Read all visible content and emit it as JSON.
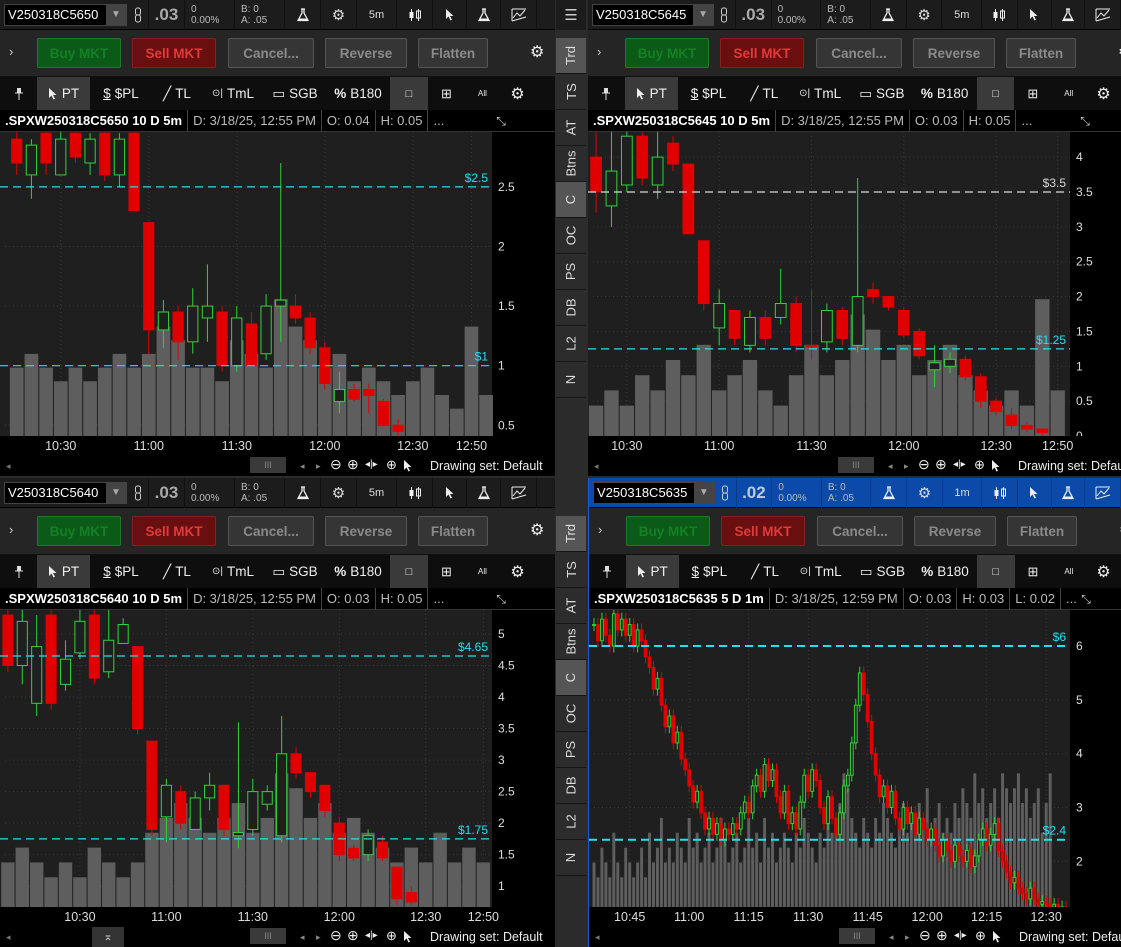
{
  "orders": {
    "buy": "Buy MKT",
    "sell": "Sell MKT",
    "cancel": "Cancel...",
    "reverse": "Reverse",
    "flatten": "Flatten"
  },
  "tools": {
    "pt": "PT",
    "pl": "$PL",
    "tl": "TL",
    "tml": "TmL",
    "sgb": "SGB",
    "b180": "B180",
    "all": "All"
  },
  "sidebar": {
    "tabs": [
      "Trd",
      "TS",
      "AT",
      "Btns",
      "C",
      "OC",
      "PS",
      "DB",
      "L2",
      "N"
    ],
    "active": [
      "Trd",
      "C"
    ]
  },
  "panels": [
    {
      "symbol": "V250318C5650",
      "last": ".03",
      "chg": "0",
      "chg_pct": "0.00%",
      "bid": "B: 0",
      "ask": "A: .05",
      "agg": "5m",
      "active": false,
      "title": ".SPXW250318C5650 10 D 5m",
      "date": "D: 3/18/25, 12:55 PM",
      "open": "O: 0.04",
      "high": "H: 0.05",
      "low": null,
      "more": "...",
      "drawing_set": "Drawing set: Default"
    },
    {
      "symbol": "V250318C5645",
      "last": ".03",
      "chg": "0",
      "chg_pct": "0.00%",
      "bid": "B: 0",
      "ask": "A: .05",
      "agg": "5m",
      "active": false,
      "title": ".SPXW250318C5645 10 D 5m",
      "date": "D: 3/18/25, 12:55 PM",
      "open": "O: 0.03",
      "high": "H: 0.05",
      "low": null,
      "more": "...",
      "drawing_set": "Drawing set: Default"
    },
    {
      "symbol": "V250318C5640",
      "last": ".03",
      "chg": "0",
      "chg_pct": "0.00%",
      "bid": "B: 0",
      "ask": "A: .05",
      "agg": "5m",
      "active": false,
      "title": ".SPXW250318C5640 10 D 5m",
      "date": "D: 3/18/25, 12:55 PM",
      "open": "O: 0.03",
      "high": "H: 0.05",
      "low": null,
      "more": "...",
      "drawing_set": "Drawing set: Default"
    },
    {
      "symbol": "V250318C5635",
      "last": ".02",
      "chg": "0",
      "chg_pct": "0.00%",
      "bid": "B: 0",
      "ask": "A: .05",
      "agg": "1m",
      "active": true,
      "title": ".SPXW250318C5635 5 D 1m",
      "date": "D: 3/18/25, 12:59 PM",
      "open": "O: 0.03",
      "high": "H: 0.03",
      "low": "L: 0.02",
      "more": "...",
      "drawing_set": "Drawing set: Default"
    }
  ],
  "chart_data": [
    {
      "type": "candlestick",
      "title": ".SPXW250318C5650 10 D 5m",
      "ylim": [
        0.41,
        2.96
      ],
      "yticks": [
        "0.5",
        "1",
        "1.5",
        "2",
        "2.5"
      ],
      "xrange": [
        "10:11",
        "12:57"
      ],
      "xticks": [
        "10:30",
        "11:00",
        "11:30",
        "12:00",
        "12:30",
        "12:50"
      ],
      "start": "10:15",
      "bar_minutes": 5,
      "hlines": [
        {
          "price": 2.5,
          "label": "$2.5",
          "color": "#22e0f0"
        },
        {
          "price": 1,
          "label": "$1",
          "color": "#22e0f0"
        }
      ],
      "ohlc": [
        [
          2.9,
          3.0,
          2.6,
          2.7
        ],
        [
          2.6,
          2.9,
          2.4,
          2.85
        ],
        [
          2.95,
          3.0,
          2.6,
          2.7
        ],
        [
          2.6,
          3.0,
          2.6,
          2.9
        ],
        [
          2.95,
          3.0,
          2.7,
          2.75
        ],
        [
          2.7,
          2.95,
          2.6,
          2.9
        ],
        [
          2.95,
          3.0,
          2.55,
          2.6
        ],
        [
          2.6,
          2.95,
          2.5,
          2.9
        ],
        [
          2.95,
          3.0,
          2.3,
          2.3
        ],
        [
          2.2,
          2.2,
          1.1,
          1.3
        ],
        [
          1.3,
          1.55,
          1.15,
          1.45
        ],
        [
          1.45,
          1.5,
          1.05,
          1.2
        ],
        [
          1.2,
          1.65,
          1.1,
          1.5
        ],
        [
          1.4,
          1.85,
          1.2,
          1.5
        ],
        [
          1.45,
          1.5,
          0.95,
          1.0
        ],
        [
          1.0,
          1.5,
          0.95,
          1.4
        ],
        [
          1.35,
          1.45,
          1.0,
          1.0
        ],
        [
          1.1,
          1.6,
          1.05,
          1.5
        ],
        [
          1.5,
          2.7,
          1.2,
          1.55
        ],
        [
          1.5,
          1.6,
          1.35,
          1.4
        ],
        [
          1.4,
          1.45,
          1.1,
          1.15
        ],
        [
          1.15,
          1.2,
          0.8,
          0.85
        ],
        [
          0.7,
          0.95,
          0.6,
          0.8
        ],
        [
          0.8,
          0.85,
          0.7,
          0.72
        ],
        [
          0.8,
          0.85,
          0.6,
          0.75
        ],
        [
          0.7,
          0.72,
          0.5,
          0.5
        ],
        [
          0.5,
          0.55,
          0.4,
          0.45
        ]
      ],
      "volume": [
        5,
        6,
        5,
        4,
        5,
        4,
        5,
        6,
        5,
        6,
        8,
        7,
        5,
        5,
        4,
        7,
        6,
        5,
        10,
        8,
        7,
        5,
        6,
        4,
        5,
        4,
        3,
        4,
        5,
        3,
        2,
        8,
        3,
        2
      ]
    },
    {
      "type": "candlestick",
      "title": ".SPXW250318C5645 10 D 5m",
      "ylim": [
        0,
        4.36
      ],
      "yticks": [
        "0",
        "0.5",
        "1",
        "1.5",
        "2",
        "2.5",
        "3",
        "3.5",
        "4"
      ],
      "xrange": [
        "10:19",
        "12:54"
      ],
      "xticks": [
        "10:30",
        "11:00",
        "11:30",
        "12:00",
        "12:30",
        "12:50"
      ],
      "start": "10:20",
      "bar_minutes": 5,
      "hlines": [
        {
          "price": 3.5,
          "label": "$3.5",
          "color": "#d8d8d8"
        },
        {
          "price": 1.25,
          "label": "$1.25",
          "color": "#22e0f0"
        }
      ],
      "ohlc": [
        [
          4.0,
          4.4,
          3.2,
          3.5
        ],
        [
          3.3,
          4.4,
          3.0,
          3.8
        ],
        [
          3.6,
          4.4,
          3.5,
          4.3
        ],
        [
          4.3,
          4.4,
          3.6,
          3.7
        ],
        [
          3.6,
          4.4,
          3.4,
          4.0
        ],
        [
          4.2,
          4.3,
          3.8,
          3.9
        ],
        [
          3.9,
          3.9,
          2.9,
          2.9
        ],
        [
          2.8,
          2.8,
          1.8,
          1.9
        ],
        [
          1.55,
          2.1,
          1.3,
          1.9
        ],
        [
          1.8,
          1.8,
          1.3,
          1.4
        ],
        [
          1.3,
          1.8,
          1.2,
          1.7
        ],
        [
          1.7,
          1.8,
          1.3,
          1.4
        ],
        [
          1.7,
          2.4,
          1.6,
          1.9
        ],
        [
          1.9,
          2.0,
          1.2,
          1.3
        ],
        [
          1.3,
          2.1,
          1.1,
          1.28
        ],
        [
          1.35,
          1.9,
          1.2,
          1.8
        ],
        [
          1.8,
          1.85,
          1.3,
          1.4
        ],
        [
          1.3,
          3.7,
          1.2,
          2.0
        ],
        [
          2.1,
          2.2,
          1.9,
          2.0
        ],
        [
          2.0,
          2.0,
          1.8,
          1.85
        ],
        [
          1.8,
          1.85,
          1.4,
          1.45
        ],
        [
          1.5,
          1.55,
          1.1,
          1.15
        ],
        [
          0.95,
          1.3,
          0.7,
          1.05
        ],
        [
          1.0,
          1.2,
          0.9,
          1.1
        ],
        [
          1.1,
          1.15,
          0.8,
          0.85
        ],
        [
          0.85,
          0.9,
          0.4,
          0.5
        ],
        [
          0.5,
          0.55,
          0.3,
          0.35
        ],
        [
          0.3,
          0.4,
          0.1,
          0.15
        ],
        [
          0.15,
          0.2,
          0.05,
          0.1
        ],
        [
          0.1,
          0.1,
          0.0,
          0.05
        ]
      ],
      "volume": [
        2,
        3,
        2,
        4,
        3,
        5,
        4,
        6,
        3,
        4,
        5,
        3,
        2,
        4,
        6,
        4,
        5,
        8,
        7,
        5,
        6,
        4,
        5,
        6,
        4,
        3,
        2,
        3,
        2,
        9,
        3,
        2
      ]
    },
    {
      "type": "candlestick",
      "title": ".SPXW250318C5640 10 D 5m",
      "ylim": [
        0.67,
        5.38
      ],
      "yticks": [
        "1",
        "1.5",
        "2",
        "2.5",
        "3",
        "3.5",
        "4",
        "4.5",
        "5"
      ],
      "xrange": [
        "10:04",
        "12:53"
      ],
      "xticks": [
        "10:30",
        "11:00",
        "11:30",
        "12:00",
        "12:30",
        "12:50"
      ],
      "start": "10:05",
      "bar_minutes": 5,
      "hlines": [
        {
          "price": 4.65,
          "label": "$4.65",
          "color": "#22e0f0"
        },
        {
          "price": 1.75,
          "label": "$1.75",
          "color": "#22e0f0"
        }
      ],
      "ohlc": [
        [
          5.3,
          5.4,
          4.4,
          4.5
        ],
        [
          4.5,
          5.4,
          4.2,
          5.2
        ],
        [
          3.9,
          5.3,
          3.7,
          4.8
        ],
        [
          5.3,
          5.4,
          3.8,
          3.9
        ],
        [
          4.2,
          4.9,
          4.1,
          4.6
        ],
        [
          4.7,
          5.4,
          4.6,
          5.2
        ],
        [
          5.3,
          5.4,
          4.2,
          4.3
        ],
        [
          4.4,
          5.4,
          4.3,
          4.9
        ],
        [
          4.85,
          5.25,
          4.85,
          5.15
        ],
        [
          4.8,
          4.8,
          3.4,
          3.5
        ],
        [
          3.3,
          3.3,
          1.8,
          1.9
        ],
        [
          2.1,
          2.7,
          1.7,
          2.6
        ],
        [
          2.5,
          2.6,
          1.9,
          2.0
        ],
        [
          1.9,
          2.5,
          1.9,
          2.4
        ],
        [
          2.4,
          2.8,
          2.2,
          2.6
        ],
        [
          2.6,
          2.6,
          1.8,
          1.9
        ],
        [
          1.8,
          3.6,
          1.6,
          1.85
        ],
        [
          1.9,
          2.7,
          1.8,
          2.5
        ],
        [
          2.3,
          2.6,
          2.2,
          2.5
        ],
        [
          1.8,
          3.7,
          1.7,
          3.1
        ],
        [
          3.1,
          3.2,
          2.7,
          2.8
        ],
        [
          2.8,
          2.8,
          2.4,
          2.5
        ],
        [
          2.6,
          2.6,
          2.1,
          2.2
        ],
        [
          2.0,
          2.1,
          1.4,
          1.5
        ],
        [
          1.6,
          1.65,
          1.4,
          1.45
        ],
        [
          1.5,
          1.9,
          1.4,
          1.8
        ],
        [
          1.7,
          1.8,
          1.4,
          1.45
        ],
        [
          1.3,
          1.3,
          0.7,
          0.8
        ],
        [
          0.9,
          1.0,
          0.7,
          0.75
        ]
      ],
      "volume": [
        3,
        4,
        3,
        2,
        3,
        2,
        4,
        3,
        2,
        3,
        5,
        6,
        7,
        6,
        5,
        6,
        7,
        5,
        6,
        9,
        8,
        6,
        7,
        5,
        6,
        5,
        4,
        3,
        4,
        3,
        5,
        3,
        4,
        3
      ]
    },
    {
      "type": "candlestick",
      "title": ".SPXW250318C5635 5 D 1m",
      "ylim": [
        1.15,
        6.67
      ],
      "yticks": [
        "2",
        "3",
        "4",
        "5",
        "6"
      ],
      "xrange": [
        "10:36",
        "12:36"
      ],
      "xticks": [
        "10:45",
        "11:00",
        "11:15",
        "11:30",
        "11:45",
        "12:00",
        "12:15",
        "12:30"
      ],
      "start": "10:36",
      "bar_minutes": 1,
      "hlines": [
        {
          "price": 6,
          "label": "$6",
          "color": "#22e0f0"
        },
        {
          "price": 2.4,
          "label": "$2.4",
          "color": "#22e0f0"
        }
      ],
      "closes": [
        6.4,
        6.1,
        6.5,
        6.2,
        6.0,
        6.6,
        6.3,
        6.5,
        6.2,
        6.4,
        6.0,
        6.3,
        6.1,
        5.8,
        5.6,
        5.2,
        5.4,
        4.9,
        4.5,
        4.7,
        4.2,
        4.4,
        3.9,
        3.7,
        3.4,
        3.1,
        3.3,
        2.9,
        2.6,
        2.8,
        2.5,
        2.7,
        2.4,
        2.6,
        2.5,
        2.7,
        2.6,
        2.9,
        3.1,
        2.9,
        3.4,
        3.6,
        3.3,
        3.8,
        3.5,
        3.7,
        3.2,
        2.9,
        3.3,
        2.7,
        2.9,
        2.6,
        3.1,
        3.6,
        3.3,
        3.7,
        3.5,
        3.0,
        2.7,
        3.2,
        2.8,
        2.5,
        2.9,
        3.4,
        3.6,
        4.2,
        4.9,
        5.5,
        5.1,
        4.6,
        4.0,
        3.6,
        3.2,
        3.4,
        3.0,
        3.3,
        2.8,
        2.6,
        3.0,
        2.7,
        2.9,
        2.5,
        2.8,
        2.6,
        2.4,
        2.6,
        2.3,
        2.1,
        2.4,
        2.2,
        2.0,
        2.3,
        2.1,
        2.0,
        2.2,
        1.9,
        2.1,
        2.4,
        2.6,
        2.3,
        2.5,
        2.7,
        2.2,
        2.0,
        1.8,
        1.6,
        1.7,
        1.5,
        1.4,
        1.3,
        1.5,
        1.3,
        1.2,
        1.25,
        1.2,
        1.15,
        1.2,
        1.1,
        1.15,
        1.1
      ],
      "volume": [
        3,
        2,
        4,
        3,
        2,
        5,
        3,
        2,
        4,
        3,
        2,
        3,
        4,
        2,
        5,
        3,
        4,
        6,
        3,
        4,
        3,
        5,
        4,
        3,
        6,
        4,
        5,
        3,
        4,
        5,
        3,
        4,
        6,
        5,
        3,
        4,
        5,
        3,
        4,
        6,
        4,
        5,
        3,
        6,
        4,
        5,
        3,
        4,
        5,
        4,
        3,
        5,
        4,
        6,
        5,
        4,
        3,
        5,
        4,
        6,
        5,
        6,
        7,
        9,
        8,
        6,
        5,
        4,
        6,
        5,
        4,
        6,
        5,
        7,
        6,
        5,
        4,
        6,
        7,
        5,
        6,
        5,
        7,
        6,
        8,
        5,
        6,
        7,
        5,
        6,
        5,
        7,
        6,
        8,
        7,
        6,
        9,
        7,
        8,
        6,
        7,
        8,
        6,
        9,
        8,
        7,
        8,
        9,
        7,
        8,
        6,
        7,
        8,
        5,
        7,
        9
      ]
    }
  ]
}
